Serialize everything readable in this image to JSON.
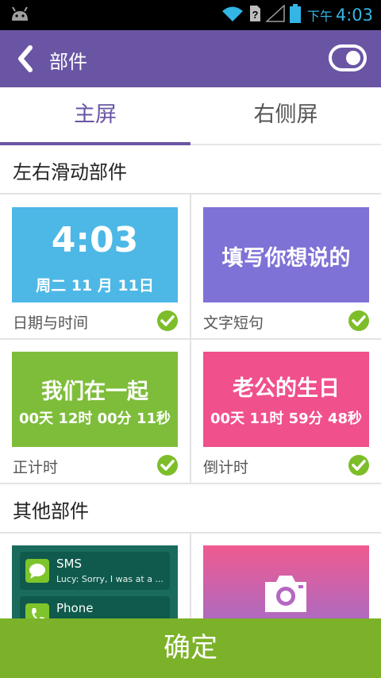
{
  "status_bar": {
    "ampm": "下午",
    "time": "4:03",
    "icons": [
      "android-icon",
      "wifi-icon",
      "no-sim-icon",
      "signal-icon",
      "battery-icon"
    ]
  },
  "action_bar": {
    "title": "部件",
    "back_icon": "chevron-left-icon",
    "toggle_icon": "toggle-icon"
  },
  "tabs": [
    {
      "label": "主屏",
      "active": true
    },
    {
      "label": "右侧屏",
      "active": false
    }
  ],
  "sections": {
    "swipe_widgets": "左右滑动部件",
    "other_widgets": "其他部件"
  },
  "widgets": {
    "datetime": {
      "time": "4:03",
      "date": "周二 11 月 11日",
      "caption": "日期与时间",
      "color": "#4db8e6"
    },
    "text": {
      "text": "填写你想说的",
      "caption": "文字短句",
      "color": "#7e72d6"
    },
    "countup": {
      "title": "我们在一起",
      "value": "00天 12时 00分 11秒",
      "caption": "正计时",
      "color": "#7ebd3a"
    },
    "countdown": {
      "title": "老公的生日",
      "value": "00天 11时 59分 48秒",
      "caption": "倒计时",
      "color": "#f0508c"
    },
    "messages": {
      "color": "#1a6b5c",
      "items": [
        {
          "title": "SMS",
          "body": "Lucy: Sorry, I was at a ..."
        },
        {
          "title": "Phone",
          "body": ""
        }
      ]
    },
    "camera": {
      "icon": "camera-icon",
      "colors": [
        "#f05a90",
        "#8e72d8"
      ]
    }
  },
  "confirm_button": "确定",
  "accent_color": "#6a55a5"
}
